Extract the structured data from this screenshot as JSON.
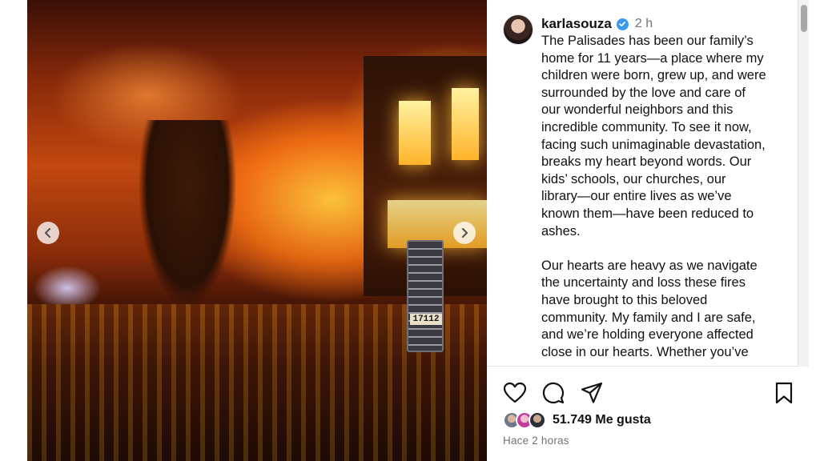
{
  "post": {
    "username": "karlasouza",
    "time_short": "2 h",
    "caption": "The Palisades has been our family’s\nhome for 11 years—a place where my\nchildren were born, grew up, and were\nsurrounded by the love and care of\nour wonderful neighbors and this\nincredible community. To see it now,\nfacing such unimaginable devastation,\nbreaks my heart beyond words. Our\nkids’ schools, our churches, our\nlibrary—our entire lives as we’ve\nknown them—have been reduced to\nashes.\n\nOur hearts are heavy as we navigate\nthe uncertainty and loss these fires\nhave brought to this beloved\ncommunity. My family and I are safe,\nand we’re holding everyone affected\nclose in our hearts. Whether you’ve",
    "likes": "51.749 Me gusta",
    "posted_ago": "Hace 2 horas"
  },
  "media": {
    "address_number": "17112"
  },
  "icons": {
    "like": "heart-outline-icon",
    "comment": "comment-bubble-icon",
    "share": "paper-plane-icon",
    "save": "bookmark-outline-icon",
    "verified": "verified-badge-icon",
    "prev": "chevron-left-icon",
    "next": "chevron-right-icon"
  },
  "colors": {
    "verified": "#3897f0",
    "text": "#111111",
    "muted": "#737373"
  }
}
